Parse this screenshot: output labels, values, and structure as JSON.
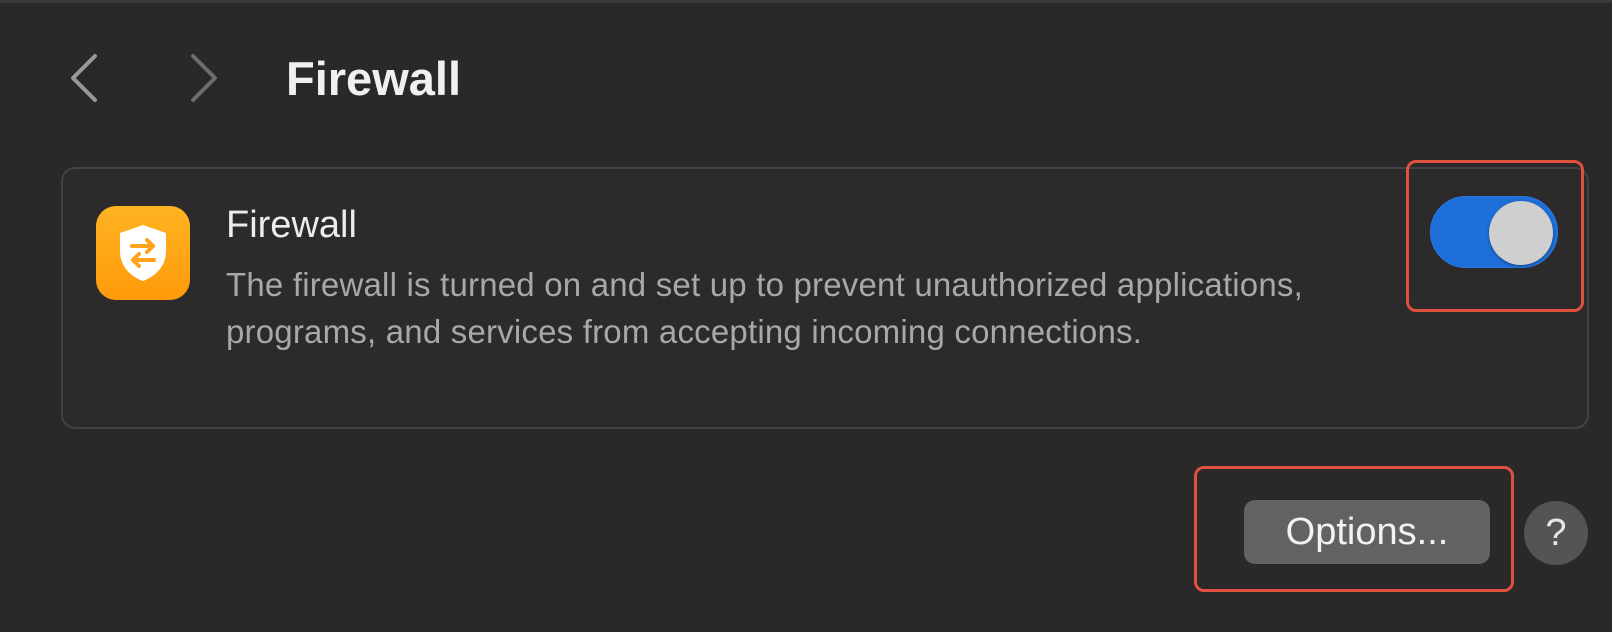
{
  "header": {
    "back_icon": "chevron-left-icon",
    "forward_icon": "chevron-right-icon",
    "title": "Firewall"
  },
  "firewall_row": {
    "icon": "firewall-shield-icon",
    "title": "Firewall",
    "description": "The firewall is turned on and set up to prevent unauthorized applications, programs, and services from accepting incoming connections.",
    "toggle_on": true
  },
  "footer": {
    "options_label": "Options...",
    "help_label": "?"
  },
  "colors": {
    "toggle_on": "#1e6fd9",
    "icon_orange": "#ffa41a",
    "highlight": "#e0503f"
  }
}
